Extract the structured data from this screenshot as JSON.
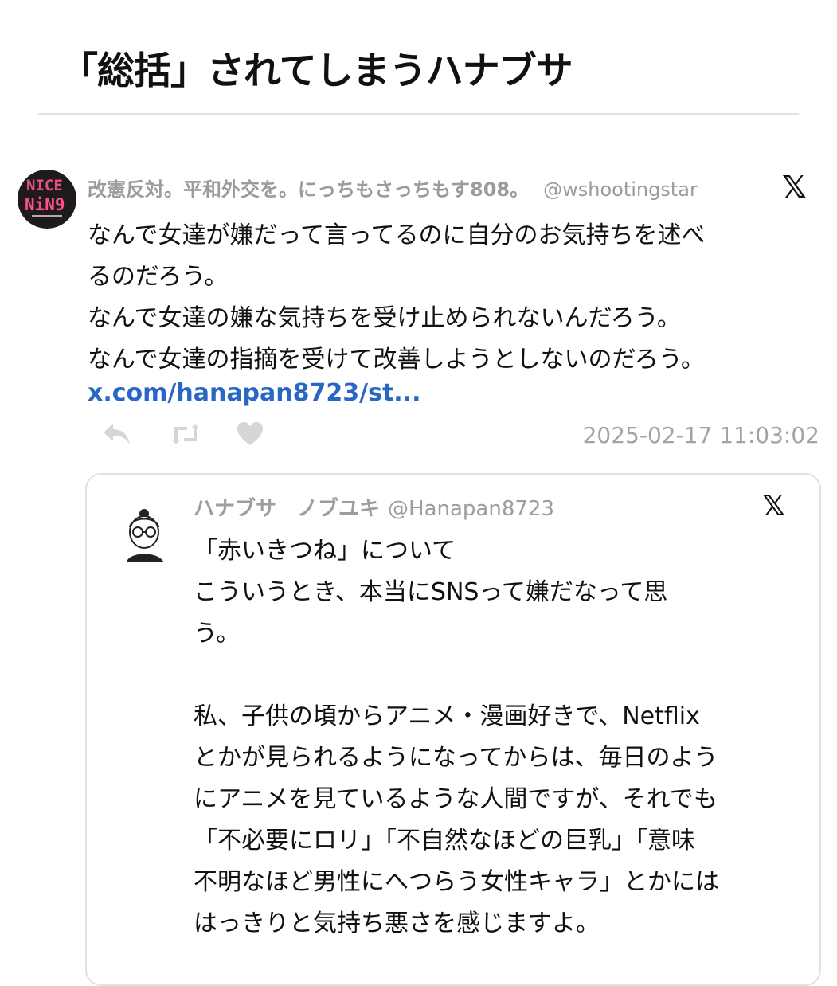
{
  "page_title": "「総括」されてしまうハナブサ",
  "tweet": {
    "avatar": {
      "line1": "NICE",
      "line2": "NiN9",
      "alt": "avatar"
    },
    "author_name": "改憲反対。平和外交を。にっちもさっちもす808。",
    "author_handle": "@wshootingstar",
    "x_logo_icon": "x-logo",
    "lines": [
      "なんで女達が嫌だって言ってるのに自分のお気持ちを述べ",
      "るのだろう。",
      "なんで女達の嫌な気持ちを受け止められないんだろう。",
      "なんで女達の指摘を受けて改善しようとしないのだろう。"
    ],
    "link": "x.com/hanapan8723/st...",
    "actions": {
      "reply_icon": "reply-icon",
      "retweet_icon": "retweet-icon",
      "like_icon": "heart-icon"
    },
    "timestamp": "2025-02-17 11:03:02"
  },
  "quoted_tweet": {
    "author_name": "ハナブサ　ノブユキ",
    "author_handle": "@Hanapan8723",
    "x_logo_icon": "x-logo",
    "lines": [
      "「赤いきつね」について",
      "こういうとき、本当にSNSって嫌だなって思",
      "う。",
      "",
      "私、子供の頃からアニメ・漫画好きで、Netflix",
      "とかが見られるようになってからは、毎日のよう",
      "にアニメを見ているような人間ですが、それでも",
      "「不必要にロリ」「不自然なほどの巨乳」「意味",
      "不明なほど男性にへつらう女性キャラ」とかには",
      "はっきりと気持ち悪さを感じますよ。"
    ]
  },
  "colors": {
    "link": "#2a66c6",
    "muted": "#9b9b9b",
    "action_icon": "#d6d6d6",
    "card_border": "#e1e1e1",
    "avatar_accent": "#ff4f86"
  }
}
